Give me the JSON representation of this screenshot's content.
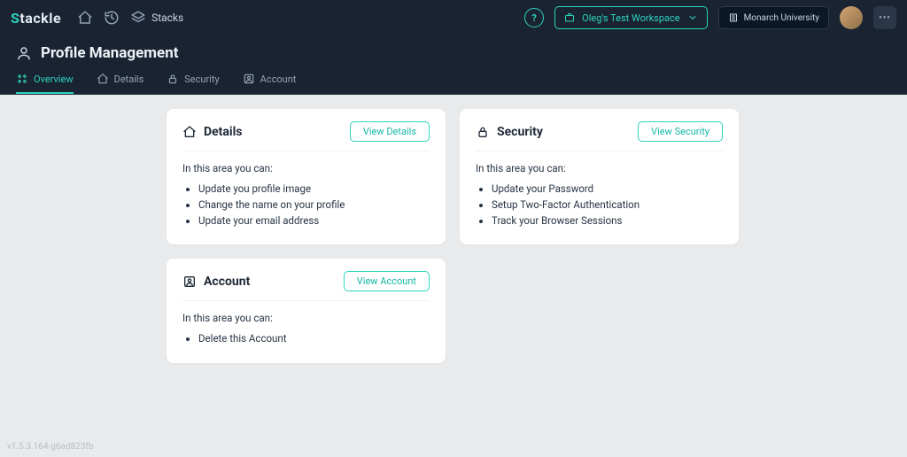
{
  "brand": {
    "first": "S",
    "rest": "tackle"
  },
  "topnav": {
    "stacks_label": "Stacks",
    "workspace_label": "Oleg's Test Workspace",
    "university_label": "Monarch University"
  },
  "page": {
    "title": "Profile Management"
  },
  "tabs": {
    "overview": "Overview",
    "details": "Details",
    "security": "Security",
    "account": "Account"
  },
  "cards": {
    "details": {
      "title": "Details",
      "button": "View Details",
      "intro": "In this area you can:",
      "items": [
        "Update you profile image",
        "Change the name on your profile",
        "Update your email address"
      ]
    },
    "security": {
      "title": "Security",
      "button": "View Security",
      "intro": "In this area you can:",
      "items": [
        "Update your Password",
        "Setup Two-Factor Authentication",
        "Track your Browser Sessions"
      ]
    },
    "account": {
      "title": "Account",
      "button": "View Account",
      "intro": "In this area you can:",
      "items": [
        "Delete this Account"
      ]
    }
  },
  "footer": {
    "version": "v1.5.3.164-g6ad823fb"
  }
}
